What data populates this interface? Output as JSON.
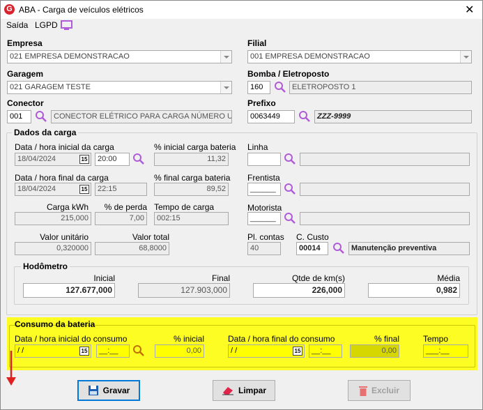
{
  "window": {
    "title": "ABA - Carga de veículos elétricos",
    "logo_letter": "G",
    "close": "✕"
  },
  "menu": {
    "saida": "Saída",
    "lgpd": "LGPD"
  },
  "empresa": {
    "label": "Empresa",
    "value": "021 EMPRESA DEMONSTRACAO"
  },
  "filial": {
    "label": "Filial",
    "value": "001 EMPRESA DEMONSTRACAO"
  },
  "garagem": {
    "label": "Garagem",
    "value": "021 GARAGEM TESTE"
  },
  "bomba": {
    "label": "Bomba / Eletroposto",
    "code": "160",
    "desc": "ELETROPOSTO 1"
  },
  "conector": {
    "label": "Conector",
    "code": "001",
    "desc": "CONECTOR ELÉTRICO PARA CARGA NÚMERO UN"
  },
  "prefixo": {
    "label": "Prefixo",
    "code": "0063449",
    "plate": "ZZZ-9999"
  },
  "dados": {
    "title": "Dados da carga",
    "dt_inicial_label": "Data / hora inicial da carga",
    "dt_inicial_date": "18/04/2024",
    "dt_inicial_time": "20:00",
    "pct_inicial_label": "% inicial carga bateria",
    "pct_inicial": "11,32",
    "dt_final_label": "Data / hora final da carga",
    "dt_final_date": "18/04/2024",
    "dt_final_time": "22:15",
    "pct_final_label": "% final carga bateria",
    "pct_final": "89,52",
    "carga_label": "Carga kWh",
    "carga": "215,000",
    "perda_label": "% de perda",
    "perda": "7,00",
    "tempo_label": "Tempo de carga",
    "tempo": "002:15",
    "unit_label": "Valor unitário",
    "unit": "0,320000",
    "total_label": "Valor total",
    "total": "68,8000",
    "linha_label": "Linha",
    "frentista_label": "Frentista",
    "frentista_mask": "______",
    "motorista_label": "Motorista",
    "motorista_mask": "______",
    "plcontas_label": "Pl. contas",
    "plcontas": "40",
    "ccusto_label": "C. Custo",
    "ccusto_code": "00014",
    "ccusto_desc": "Manutenção preventiva"
  },
  "hodometro": {
    "title": "Hodômetro",
    "inicial_label": "Inicial",
    "inicial": "127.677,000",
    "final_label": "Final",
    "final": "127.903,000",
    "km_label": "Qtde de km(s)",
    "km": "226,000",
    "media_label": "Média",
    "media": "0,982"
  },
  "consumo": {
    "title": "Consumo da bateria",
    "dt_inicial_label": "Data / hora inicial do consumo",
    "dt_inicial_date": " / /",
    "dt_inicial_time": "__:__",
    "pct_inicial_label": "% inicial",
    "pct_inicial": "0,00",
    "dt_final_label": "Data / hora final do consumo",
    "dt_final_date": " / /",
    "dt_final_time": "__:__",
    "pct_final_label": "% final",
    "pct_final": "0,00",
    "tempo_label": "Tempo",
    "tempo": "___:__"
  },
  "buttons": {
    "gravar": "Gravar",
    "limpar": "Limpar",
    "excluir": "Excluir"
  },
  "calendar_glyph": "15",
  "colors": {
    "highlight": "#ffff00",
    "search_icon": "#b05bd8",
    "arrow": "#e02020",
    "focus": "#0078d7"
  }
}
